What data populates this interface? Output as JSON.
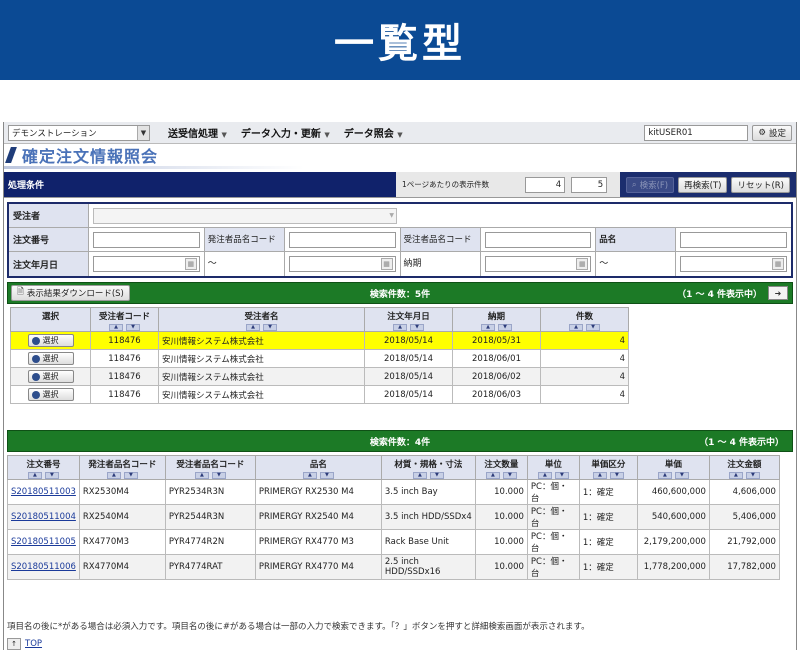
{
  "banner": {
    "title": "一覧型"
  },
  "menubar": {
    "mode_select": "デモンストレーション",
    "menus": [
      "送受信処理",
      "データ入力・更新",
      "データ照会"
    ],
    "user_id": "kitUSER01",
    "settings_label": "設定"
  },
  "page": {
    "title": "確定注文情報照会"
  },
  "conditions": {
    "label": "処理条件",
    "per_page_label": "1ページあたりの表示件数",
    "per_page_values": [
      "4",
      "5"
    ],
    "buttons": {
      "search": "検索(F)",
      "research": "再検索(T)",
      "reset": "リセット(R)"
    },
    "fields": {
      "orderer": "受注者",
      "order_no": "注文番号",
      "orderer_item_code": "発注者品名コード",
      "receiver_item_code": "受注者品名コード",
      "item_name": "品名",
      "order_date": "注文年月日",
      "tilde": "〜",
      "delivery": "納期"
    }
  },
  "result1": {
    "download_label": "表示結果ダウンロード(S)",
    "count_label": "検索件数：5件",
    "range_label": "（1 〜 4 件表示中）",
    "columns": [
      "選択",
      "受注者コード",
      "受注者名",
      "注文年月日",
      "納期",
      "件数"
    ],
    "select_label": "選択",
    "rows": [
      {
        "code": "118476",
        "name": "安川情報システム株式会社",
        "order_date": "2018/05/14",
        "delivery": "2018/05/31",
        "count": "4"
      },
      {
        "code": "118476",
        "name": "安川情報システム株式会社",
        "order_date": "2018/05/14",
        "delivery": "2018/06/01",
        "count": "4"
      },
      {
        "code": "118476",
        "name": "安川情報システム株式会社",
        "order_date": "2018/05/14",
        "delivery": "2018/06/02",
        "count": "4"
      },
      {
        "code": "118476",
        "name": "安川情報システム株式会社",
        "order_date": "2018/05/14",
        "delivery": "2018/06/03",
        "count": "4"
      }
    ]
  },
  "result2": {
    "count_label": "検索件数：4件",
    "range_label": "（1 〜 4 件表示中）",
    "columns": [
      "注文番号",
      "発注者品名コード",
      "受注者品名コード",
      "品名",
      "材質・規格・寸法",
      "注文数量",
      "単位",
      "単価区分",
      "単価",
      "注文金額"
    ],
    "rows": [
      {
        "no": "S20180511003",
        "ocode": "RX2530M4",
        "rcode": "PYR2534R3N",
        "name": "PRIMERGY RX2530 M4",
        "spec": "3.5 inch Bay",
        "qty": "10.000",
        "unit": "PC：個・台",
        "ptype": "1：確定",
        "price": "460,600,000",
        "amount": "4,606,000"
      },
      {
        "no": "S20180511004",
        "ocode": "RX2540M4",
        "rcode": "PYR2544R3N",
        "name": "PRIMERGY RX2540 M4",
        "spec": "3.5 inch HDD/SSDx4",
        "qty": "10.000",
        "unit": "PC：個・台",
        "ptype": "1：確定",
        "price": "540,600,000",
        "amount": "5,406,000"
      },
      {
        "no": "S20180511005",
        "ocode": "RX4770M3",
        "rcode": "PYR4774R2N",
        "name": "PRIMERGY RX4770 M3",
        "spec": "Rack Base Unit",
        "qty": "10.000",
        "unit": "PC：個・台",
        "ptype": "1：確定",
        "price": "2,179,200,000",
        "amount": "21,792,000"
      },
      {
        "no": "S20180511006",
        "ocode": "RX4770M4",
        "rcode": "PYR4774RAT",
        "name": "PRIMERGY RX4770 M4",
        "spec": "2.5 inch HDD/SSDx16",
        "qty": "10.000",
        "unit": "PC：個・台",
        "ptype": "1：確定",
        "price": "1,778,200,000",
        "amount": "17,782,000"
      }
    ]
  },
  "footer": {
    "note": "項目名の後に*がある場合は必須入力です。項目名の後に#がある場合は一部の入力で検索できます。「？」ボタンを押すと詳細検索画面が表示されます。",
    "top_link": "TOP"
  }
}
